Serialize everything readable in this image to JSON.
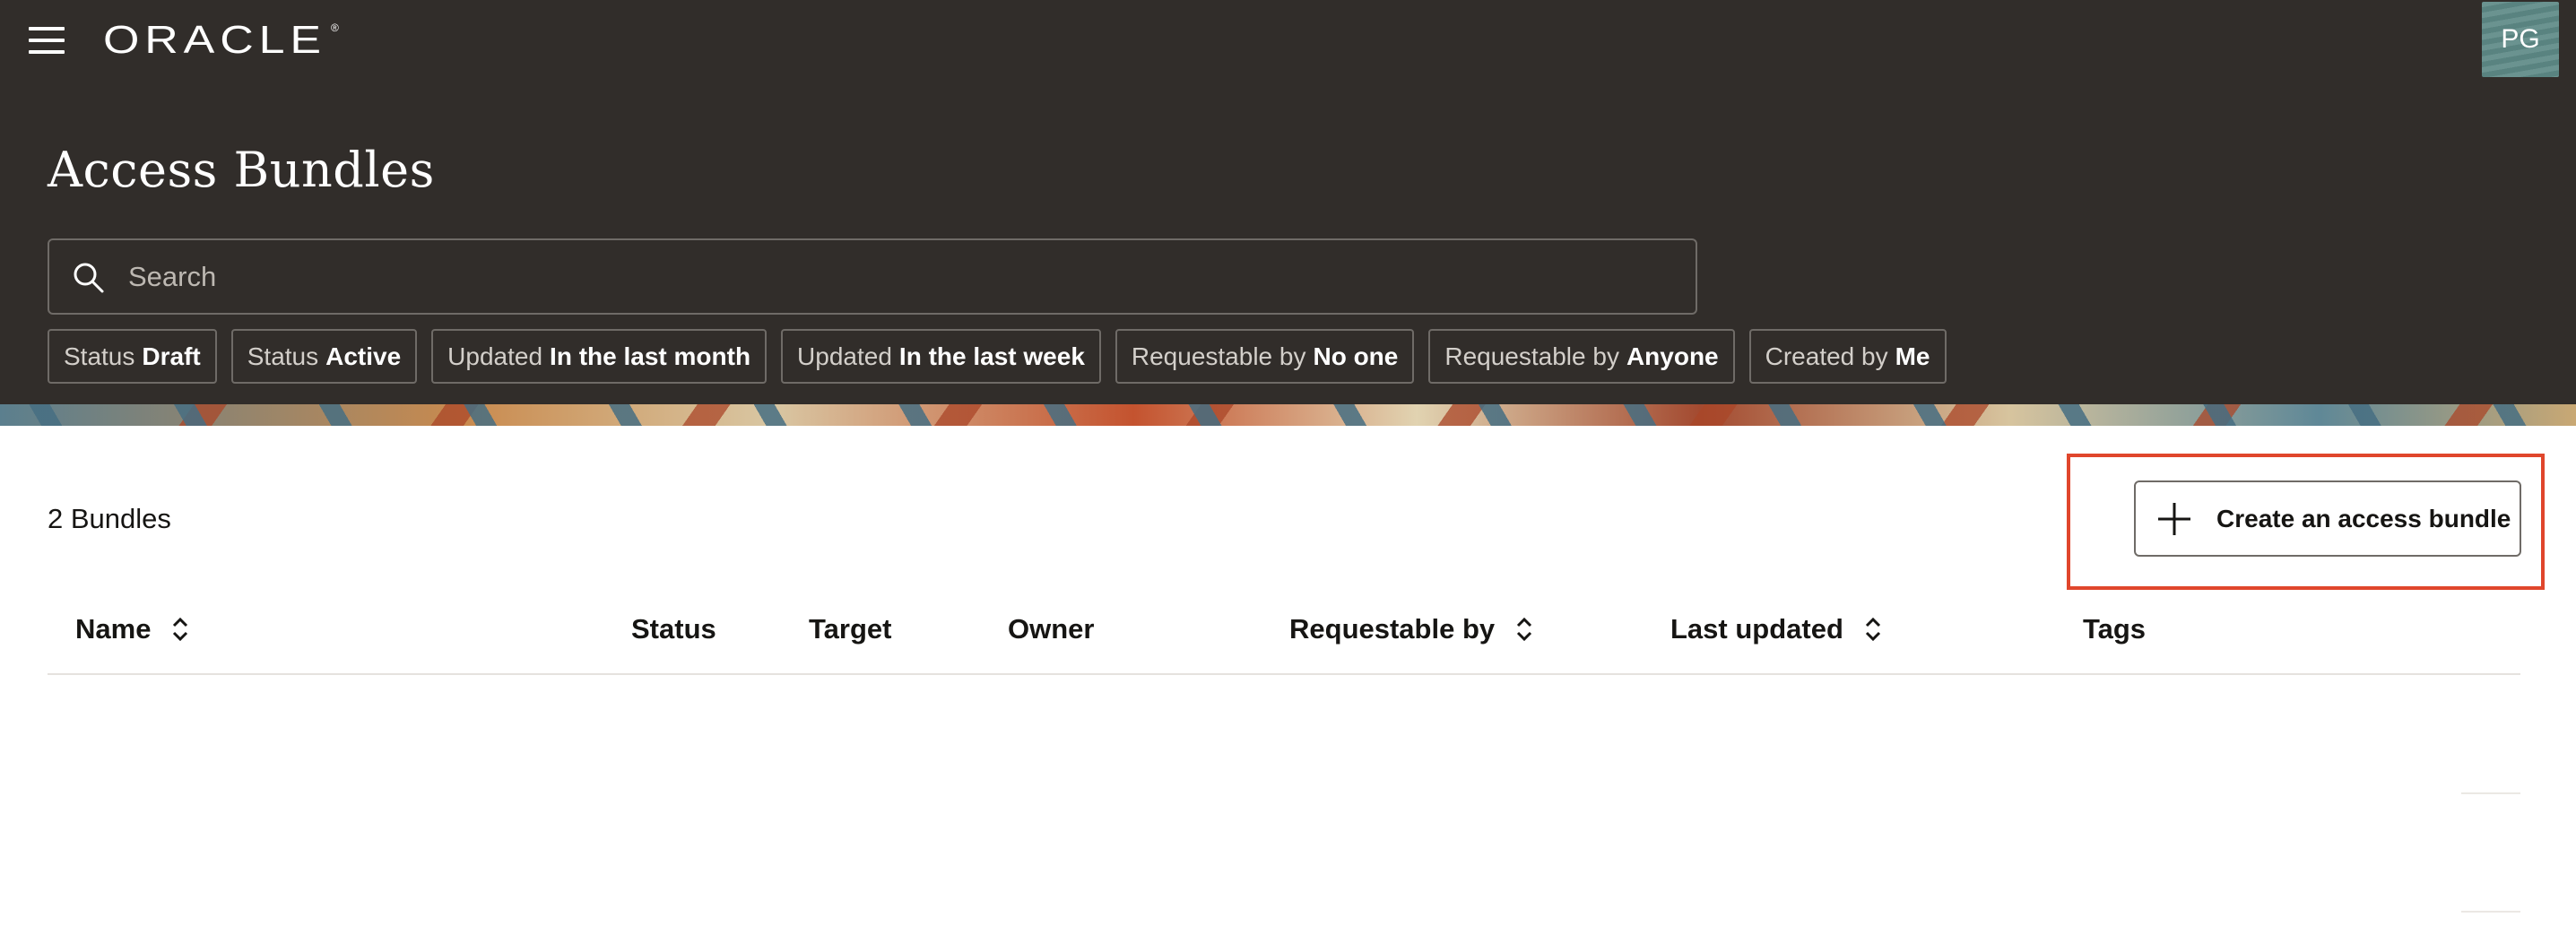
{
  "header": {
    "logo_text": "ORACLE",
    "logo_mark": "®",
    "avatar_initials": "PG",
    "menu_icon": "hamburger-menu-icon"
  },
  "page": {
    "title": "Access Bundles"
  },
  "search": {
    "placeholder": "Search",
    "value": "",
    "icon": "search-icon"
  },
  "filters": [
    {
      "key": "Status",
      "value": "Draft"
    },
    {
      "key": "Status",
      "value": "Active"
    },
    {
      "key": "Updated",
      "value": "In the last month"
    },
    {
      "key": "Updated",
      "value": "In the last week"
    },
    {
      "key": "Requestable by",
      "value": "No one"
    },
    {
      "key": "Requestable by",
      "value": "Anyone"
    },
    {
      "key": "Created by",
      "value": "Me"
    }
  ],
  "results": {
    "count_label": "2 Bundles"
  },
  "actions": {
    "create_label": "Create an access bundle",
    "highlight_color": "#e0462c"
  },
  "table": {
    "columns": [
      {
        "label": "Name",
        "sortable": true
      },
      {
        "label": "Status",
        "sortable": false
      },
      {
        "label": "Target",
        "sortable": false
      },
      {
        "label": "Owner",
        "sortable": false
      },
      {
        "label": "Requestable by",
        "sortable": true
      },
      {
        "label": "Last updated",
        "sortable": true
      },
      {
        "label": "Tags",
        "sortable": false
      }
    ],
    "rows": []
  },
  "colors": {
    "header_bg": "#312d2a",
    "text_primary": "#161513"
  }
}
